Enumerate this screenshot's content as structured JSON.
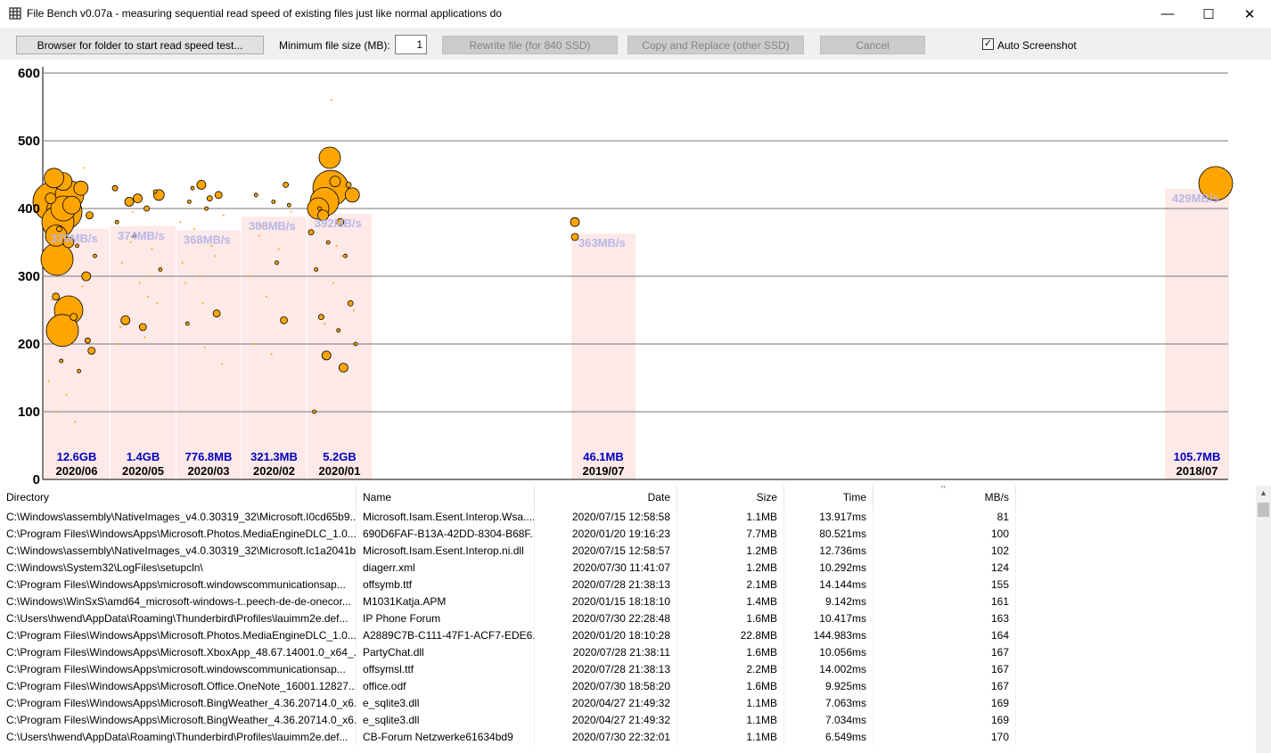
{
  "window": {
    "title": "File Bench v0.07a - measuring sequential read speed of existing files just like normal applications do",
    "min_glyph": "—",
    "max_glyph": "☐",
    "close_glyph": "✕"
  },
  "toolbar": {
    "browse_label": "Browser for folder to start read speed test...",
    "min_size_label": "Minimum file size (MB):",
    "min_size_value": "1",
    "rewrite_label": "Rewrite file (for 840 SSD)",
    "copy_label": "Copy and Replace (other SSD)",
    "cancel_label": "Cancel",
    "auto_screenshot_label": "Auto Screenshot",
    "auto_screenshot_checked": true
  },
  "chart_data": {
    "type": "scatter",
    "title": "",
    "xlabel": "",
    "ylabel": "",
    "ylim": [
      0,
      600
    ],
    "yticks": [
      0,
      100,
      200,
      300,
      400,
      500,
      600
    ],
    "grid": true,
    "colors": {
      "point": "#ffa500",
      "band": "#fde9e7",
      "size_label": "#0000bf",
      "speed_label": "#b7b7e8"
    },
    "groups": [
      {
        "month": "2020/06",
        "total_size": "12.6GB",
        "avg_speed": "370MB/s",
        "avg": 370
      },
      {
        "month": "2020/05",
        "total_size": "1.4GB",
        "avg_speed": "374MB/s",
        "avg": 374
      },
      {
        "month": "2020/03",
        "total_size": "776.8MB",
        "avg_speed": "368MB/s",
        "avg": 368
      },
      {
        "month": "2020/02",
        "total_size": "321.3MB",
        "avg_speed": "388MB/s",
        "avg": 388
      },
      {
        "month": "2020/01",
        "total_size": "5.2GB",
        "avg_speed": "392MB/s",
        "avg": 392
      },
      {
        "month": "2019/07",
        "total_size": "46.1MB",
        "avg_speed": "363MB/s",
        "avg": 363
      },
      {
        "month": "2018/07",
        "total_size": "105.7MB",
        "avg_speed": "429MB/s",
        "avg": 429
      }
    ],
    "points": [
      {
        "g": 0,
        "y": 410,
        "s": 22
      },
      {
        "g": 0,
        "y": 395,
        "s": 20
      },
      {
        "g": 0,
        "y": 380,
        "s": 18
      },
      {
        "g": 0,
        "y": 420,
        "s": 16
      },
      {
        "g": 0,
        "y": 400,
        "s": 14
      },
      {
        "g": 0,
        "y": 325,
        "s": 18
      },
      {
        "g": 0,
        "y": 250,
        "s": 16
      },
      {
        "g": 0,
        "y": 220,
        "s": 18
      },
      {
        "g": 0,
        "y": 360,
        "s": 12
      },
      {
        "g": 0,
        "y": 440,
        "s": 10
      },
      {
        "g": 0,
        "y": 430,
        "s": 8
      },
      {
        "g": 0,
        "y": 415,
        "s": 6
      },
      {
        "g": 0,
        "y": 350,
        "s": 6
      },
      {
        "g": 0,
        "y": 300,
        "s": 5
      },
      {
        "g": 0,
        "y": 270,
        "s": 4
      },
      {
        "g": 0,
        "y": 240,
        "s": 4
      },
      {
        "g": 0,
        "y": 190,
        "s": 4
      },
      {
        "g": 0,
        "y": 175,
        "s": 2
      },
      {
        "g": 0,
        "y": 160,
        "s": 2
      },
      {
        "g": 0,
        "y": 145,
        "s": 1
      },
      {
        "g": 0,
        "y": 125,
        "s": 1
      },
      {
        "g": 0,
        "y": 460,
        "s": 1
      },
      {
        "g": 0,
        "y": 445,
        "s": 11
      },
      {
        "g": 0,
        "y": 405,
        "s": 10
      },
      {
        "g": 0,
        "y": 390,
        "s": 4
      },
      {
        "g": 0,
        "y": 370,
        "s": 3
      },
      {
        "g": 0,
        "y": 345,
        "s": 2
      },
      {
        "g": 0,
        "y": 330,
        "s": 2
      },
      {
        "g": 0,
        "y": 310,
        "s": 1
      },
      {
        "g": 0,
        "y": 285,
        "s": 1
      },
      {
        "g": 0,
        "y": 265,
        "s": 1
      },
      {
        "g": 0,
        "y": 235,
        "s": 1
      },
      {
        "g": 0,
        "y": 205,
        "s": 3
      },
      {
        "g": 0,
        "y": 100,
        "s": 1
      },
      {
        "g": 0,
        "y": 85,
        "s": 1
      },
      {
        "g": 1,
        "y": 420,
        "s": 6
      },
      {
        "g": 1,
        "y": 410,
        "s": 5
      },
      {
        "g": 1,
        "y": 400,
        "s": 3
      },
      {
        "g": 1,
        "y": 380,
        "s": 2
      },
      {
        "g": 1,
        "y": 360,
        "s": 2
      },
      {
        "g": 1,
        "y": 340,
        "s": 1
      },
      {
        "g": 1,
        "y": 320,
        "s": 1
      },
      {
        "g": 1,
        "y": 290,
        "s": 1
      },
      {
        "g": 1,
        "y": 260,
        "s": 1
      },
      {
        "g": 1,
        "y": 235,
        "s": 2
      },
      {
        "g": 1,
        "y": 210,
        "s": 1
      },
      {
        "g": 1,
        "y": 430,
        "s": 3
      },
      {
        "g": 1,
        "y": 395,
        "s": 1
      },
      {
        "g": 1,
        "y": 300,
        "s": 1
      },
      {
        "g": 1,
        "y": 225,
        "s": 1
      },
      {
        "g": 1,
        "y": 415,
        "s": 5
      },
      {
        "g": 1,
        "y": 425,
        "s": 2
      },
      {
        "g": 1,
        "y": 235,
        "s": 5
      },
      {
        "g": 1,
        "y": 225,
        "s": 4
      },
      {
        "g": 1,
        "y": 310,
        "s": 2
      },
      {
        "g": 1,
        "y": 350,
        "s": 1
      },
      {
        "g": 1,
        "y": 270,
        "s": 1
      },
      {
        "g": 1,
        "y": 200,
        "s": 1
      },
      {
        "g": 2,
        "y": 435,
        "s": 5
      },
      {
        "g": 2,
        "y": 420,
        "s": 4
      },
      {
        "g": 2,
        "y": 410,
        "s": 2
      },
      {
        "g": 2,
        "y": 400,
        "s": 2
      },
      {
        "g": 2,
        "y": 390,
        "s": 1
      },
      {
        "g": 2,
        "y": 370,
        "s": 1
      },
      {
        "g": 2,
        "y": 345,
        "s": 1
      },
      {
        "g": 2,
        "y": 320,
        "s": 1
      },
      {
        "g": 2,
        "y": 300,
        "s": 1
      },
      {
        "g": 2,
        "y": 245,
        "s": 4
      },
      {
        "g": 2,
        "y": 230,
        "s": 2
      },
      {
        "g": 2,
        "y": 195,
        "s": 1
      },
      {
        "g": 2,
        "y": 170,
        "s": 1
      },
      {
        "g": 2,
        "y": 430,
        "s": 2
      },
      {
        "g": 2,
        "y": 415,
        "s": 3
      },
      {
        "g": 2,
        "y": 380,
        "s": 1
      },
      {
        "g": 2,
        "y": 350,
        "s": 1
      },
      {
        "g": 2,
        "y": 330,
        "s": 1
      },
      {
        "g": 2,
        "y": 290,
        "s": 1
      },
      {
        "g": 2,
        "y": 260,
        "s": 1
      },
      {
        "g": 3,
        "y": 435,
        "s": 3
      },
      {
        "g": 3,
        "y": 420,
        "s": 2
      },
      {
        "g": 3,
        "y": 410,
        "s": 2
      },
      {
        "g": 3,
        "y": 395,
        "s": 1
      },
      {
        "g": 3,
        "y": 375,
        "s": 1
      },
      {
        "g": 3,
        "y": 340,
        "s": 1
      },
      {
        "g": 3,
        "y": 300,
        "s": 1
      },
      {
        "g": 3,
        "y": 270,
        "s": 1
      },
      {
        "g": 3,
        "y": 235,
        "s": 4
      },
      {
        "g": 3,
        "y": 200,
        "s": 1
      },
      {
        "g": 3,
        "y": 185,
        "s": 1
      },
      {
        "g": 3,
        "y": 405,
        "s": 2
      },
      {
        "g": 3,
        "y": 360,
        "s": 1
      },
      {
        "g": 3,
        "y": 320,
        "s": 2
      },
      {
        "g": 4,
        "y": 430,
        "s": 20
      },
      {
        "g": 4,
        "y": 410,
        "s": 16
      },
      {
        "g": 4,
        "y": 400,
        "s": 12
      },
      {
        "g": 4,
        "y": 475,
        "s": 12
      },
      {
        "g": 4,
        "y": 440,
        "s": 6
      },
      {
        "g": 4,
        "y": 420,
        "s": 8
      },
      {
        "g": 4,
        "y": 390,
        "s": 6
      },
      {
        "g": 4,
        "y": 380,
        "s": 4
      },
      {
        "g": 4,
        "y": 365,
        "s": 3
      },
      {
        "g": 4,
        "y": 350,
        "s": 2
      },
      {
        "g": 4,
        "y": 330,
        "s": 2
      },
      {
        "g": 4,
        "y": 310,
        "s": 2
      },
      {
        "g": 4,
        "y": 290,
        "s": 1
      },
      {
        "g": 4,
        "y": 260,
        "s": 3
      },
      {
        "g": 4,
        "y": 240,
        "s": 3
      },
      {
        "g": 4,
        "y": 220,
        "s": 2
      },
      {
        "g": 4,
        "y": 200,
        "s": 2
      },
      {
        "g": 4,
        "y": 183,
        "s": 5
      },
      {
        "g": 4,
        "y": 165,
        "s": 5
      },
      {
        "g": 4,
        "y": 100,
        "s": 2
      },
      {
        "g": 4,
        "y": 560,
        "s": 1
      },
      {
        "g": 4,
        "y": 435,
        "s": 3
      },
      {
        "g": 4,
        "y": 400,
        "s": 2
      },
      {
        "g": 4,
        "y": 345,
        "s": 1
      },
      {
        "g": 4,
        "y": 250,
        "s": 1
      },
      {
        "g": 4,
        "y": 230,
        "s": 1
      },
      {
        "g": 4,
        "y": 330,
        "s": 1
      },
      {
        "g": 5,
        "y": 380,
        "s": 5
      },
      {
        "g": 5,
        "y": 358,
        "s": 4
      },
      {
        "g": 6,
        "y": 437,
        "s": 19
      }
    ]
  },
  "table": {
    "columns": [
      "Directory",
      "Name",
      "Date",
      "Size",
      "Time",
      "MB/s"
    ],
    "sort_glyph": "^",
    "scroll_up_glyph": "▲",
    "rows": [
      [
        "C:\\Windows\\assembly\\NativeImages_v4.0.30319_32\\Microsoft.I0cd65b9...",
        "Microsoft.Isam.Esent.Interop.Wsa....",
        "2020/07/15 12:58:58",
        "1.1MB",
        "13.917ms",
        "81"
      ],
      [
        "C:\\Program Files\\WindowsApps\\Microsoft.Photos.MediaEngineDLC_1.0....",
        "690D6FAF-B13A-42DD-8304-B68F...",
        "2020/01/20 19:16:23",
        "7.7MB",
        "80.521ms",
        "100"
      ],
      [
        "C:\\Windows\\assembly\\NativeImages_v4.0.30319_32\\Microsoft.Ic1a2041b...",
        "Microsoft.Isam.Esent.Interop.ni.dll",
        "2020/07/15 12:58:57",
        "1.2MB",
        "12.736ms",
        "102"
      ],
      [
        "C:\\Windows\\System32\\LogFiles\\setupcln\\",
        "diagerr.xml",
        "2020/07/30 11:41:07",
        "1.2MB",
        "10.292ms",
        "124"
      ],
      [
        "C:\\Program Files\\WindowsApps\\microsoft.windowscommunicationsap...",
        "offsymb.ttf",
        "2020/07/28 21:38:13",
        "2.1MB",
        "14.144ms",
        "155"
      ],
      [
        "C:\\Windows\\WinSxS\\amd64_microsoft-windows-t..peech-de-de-onecor...",
        "M1031Katja.APM",
        "2020/01/15 18:18:10",
        "1.4MB",
        "9.142ms",
        "161"
      ],
      [
        "C:\\Users\\hwend\\AppData\\Roaming\\Thunderbird\\Profiles\\lauimm2e.def...",
        "IP Phone Forum",
        "2020/07/30 22:28:48",
        "1.6MB",
        "10.417ms",
        "163"
      ],
      [
        "C:\\Program Files\\WindowsApps\\Microsoft.Photos.MediaEngineDLC_1.0....",
        "A2889C7B-C111-47F1-ACF7-EDE6...",
        "2020/01/20 18:10:28",
        "22.8MB",
        "144.983ms",
        "164"
      ],
      [
        "C:\\Program Files\\WindowsApps\\Microsoft.XboxApp_48.67.14001.0_x64_...",
        "PartyChat.dll",
        "2020/07/28 21:38:11",
        "1.6MB",
        "10.056ms",
        "167"
      ],
      [
        "C:\\Program Files\\WindowsApps\\microsoft.windowscommunicationsap...",
        "offsymsl.ttf",
        "2020/07/28 21:38:13",
        "2.2MB",
        "14.002ms",
        "167"
      ],
      [
        "C:\\Program Files\\WindowsApps\\Microsoft.Office.OneNote_16001.12827....",
        "office.odf",
        "2020/07/30 18:58:20",
        "1.6MB",
        "9.925ms",
        "167"
      ],
      [
        "C:\\Program Files\\WindowsApps\\Microsoft.BingWeather_4.36.20714.0_x6...",
        "e_sqlite3.dll",
        "2020/04/27 21:49:32",
        "1.1MB",
        "7.063ms",
        "169"
      ],
      [
        "C:\\Program Files\\WindowsApps\\Microsoft.BingWeather_4.36.20714.0_x6...",
        "e_sqlite3.dll",
        "2020/04/27 21:49:32",
        "1.1MB",
        "7.034ms",
        "169"
      ],
      [
        "C:\\Users\\hwend\\AppData\\Roaming\\Thunderbird\\Profiles\\lauimm2e.def...",
        "CB-Forum Netzwerke61634bd9",
        "2020/07/30 22:32:01",
        "1.1MB",
        "6.549ms",
        "170"
      ]
    ]
  }
}
